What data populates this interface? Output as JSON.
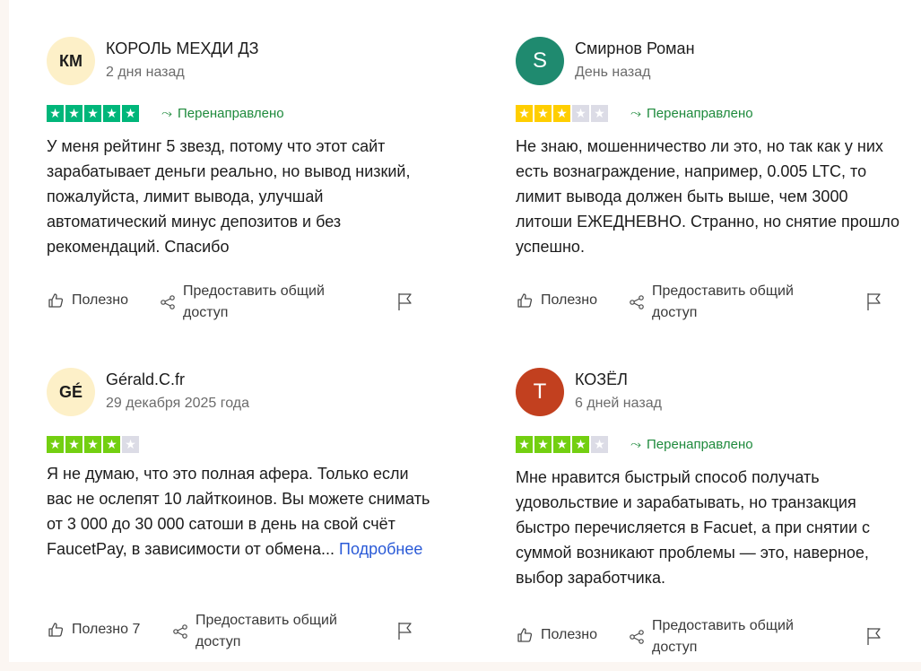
{
  "colors": {
    "green_star": "#00b67a",
    "green_light_star": "#73cf11",
    "yellow_star": "#ffce00",
    "empty_star": "#dcdce6",
    "redirect_green": "#1e8a3c",
    "link_blue": "#2a5ad7"
  },
  "reviews": [
    {
      "initials": "КМ",
      "avatar_color": "#fdf0c8",
      "name": "КОРОЛЬ МЕХДИ ДЗ",
      "date": "2 дня назад",
      "rating": 5,
      "star_color": "#00b67a",
      "redirect_label": "Перенаправлено",
      "text": "У меня рейтинг 5 звезд, потому что этот сайт зарабатывает деньги реально, но вывод низкий, пожалуйста, лимит вывода, улучшай автоматический минус депозитов и без рекомендаций. Спасибо",
      "useful_label": "Полезно",
      "share_label": "Предоставить общий доступ"
    },
    {
      "initials": "S",
      "avatar_color": "#1f8a6f",
      "name": "Смирнов Роман",
      "date": "День назад",
      "rating": 3,
      "star_color": "#ffce00",
      "redirect_label": "Перенаправлено",
      "text": "Не знаю, мошенничество ли это, но так как у них есть вознаграждение, например, 0.005 LTC, то лимит вывода должен быть выше, чем 3000 литоши ЕЖЕДНЕВНО. Странно, но снятие прошло успешно.",
      "useful_label": "Полезно",
      "share_label": "Предоставить общий доступ"
    },
    {
      "initials": "GÉ",
      "avatar_color": "#fdf0c8",
      "name": "Gérald.C.fr",
      "date": "29 декабря 2025 года",
      "rating": 4,
      "star_color": "#73cf11",
      "redirect_label": "",
      "text": "Я не думаю, что это полная афера. Только если вас не ослепят 10 лайткоинов. Вы можете снимать от 3 000 до 30 000 сатоши в день на свой счёт FaucetPay, в зависимости от обмена...",
      "more_label": "Подробнее",
      "useful_label": "Полезно 7",
      "share_label": "Предоставить общий доступ"
    },
    {
      "initials": "T",
      "avatar_color": "#c2401f",
      "name": "КОЗЁЛ",
      "date": "6 дней назад",
      "rating": 4,
      "star_color": "#73cf11",
      "redirect_label": "Перенаправлено",
      "text": "Мне нравится быстрый способ получать удовольствие и зарабатывать, но транзакция быстро перечисляется в Facuet, а при снятии с суммой возникают проблемы — это, наверное, выбор заработчика.",
      "useful_label": "Полезно",
      "share_label": "Предоставить общий доступ"
    }
  ]
}
